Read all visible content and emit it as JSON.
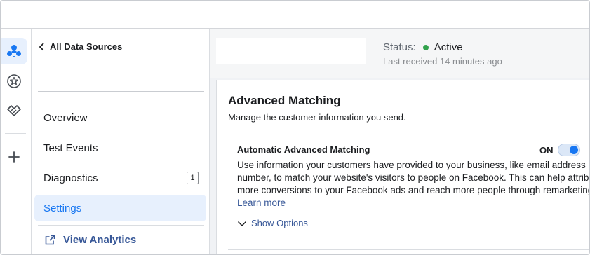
{
  "sidebar": {
    "back_label": "All Data Sources",
    "items": [
      {
        "label": "Overview"
      },
      {
        "label": "Test Events"
      },
      {
        "label": "Diagnostics",
        "badge": "1"
      },
      {
        "label": "Settings",
        "active": true
      }
    ],
    "analytics_label": "View Analytics"
  },
  "rail": {
    "icons": [
      "people-group-icon",
      "star-badge-icon",
      "handshake-icon",
      "plus-icon"
    ],
    "active_icon": "people-group-icon"
  },
  "status": {
    "label": "Status:",
    "value": "Active",
    "value_color": "#31a24c",
    "last_received": "Last received 14 minutes ago"
  },
  "advanced_matching": {
    "title": "Advanced Matching",
    "subtitle": "Manage the customer information you send.",
    "setting_title": "Automatic Advanced Matching",
    "toggle_label": "ON",
    "toggle_on": true,
    "description_lines": [
      "Use information your customers have provided to your business, like email address or phone",
      "number, to match your website's visitors to people on Facebook. This can help attribute",
      "more conversions to your Facebook ads and reach more people through remarketing"
    ],
    "learn_more": "Learn more",
    "show_options": "Show Options"
  },
  "colors": {
    "accent": "#1877f2",
    "link": "#385898",
    "active_bg": "#e7f0fd"
  }
}
